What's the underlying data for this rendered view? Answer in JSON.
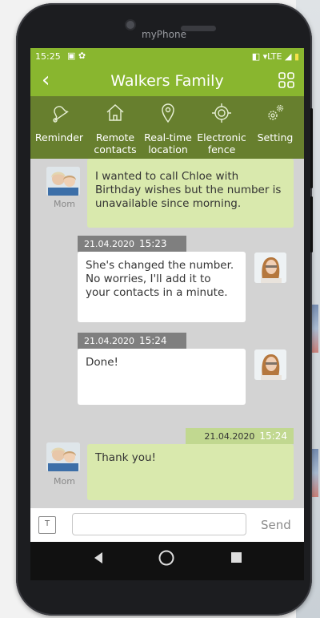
{
  "device": {
    "brand": "myPhone"
  },
  "status_bar": {
    "time": "15:25",
    "network": "LTE"
  },
  "header": {
    "title": "Walkers Family"
  },
  "toolbar": {
    "items": [
      {
        "label_line1": "Reminder",
        "label_line2": "",
        "icon": "bell-icon"
      },
      {
        "label_line1": "Remote",
        "label_line2": "contacts",
        "icon": "house-icon"
      },
      {
        "label_line1": "Real-time",
        "label_line2": "location",
        "icon": "location-pin-icon"
      },
      {
        "label_line1": "Electronic",
        "label_line2": "fence",
        "icon": "fence-target-icon"
      },
      {
        "label_line1": "Setting",
        "label_line2": "",
        "icon": "gears-icon"
      }
    ]
  },
  "messages": [
    {
      "direction": "incoming",
      "sender": "Mom",
      "text": "I wanted to call Chloe with Birthday wishes but the number is unavailable since morning."
    },
    {
      "direction": "outgoing",
      "date": "21.04.2020",
      "time": "15:23",
      "text": "She's changed the number. No worries, I'll add it to your contacts in a minute."
    },
    {
      "direction": "outgoing",
      "date": "21.04.2020",
      "time": "15:24",
      "text": "Done!"
    },
    {
      "direction": "incoming",
      "sender": "Mom",
      "date": "21.04.2020",
      "time": "15:24",
      "text": "Thank you!"
    }
  ],
  "input": {
    "value": "",
    "send_label": "Send"
  },
  "colors": {
    "header_green": "#89b62f",
    "toolbar_green": "#677f2e",
    "incoming_bubble": "#d9e9ad",
    "outgoing_bubble": "#ffffff"
  }
}
